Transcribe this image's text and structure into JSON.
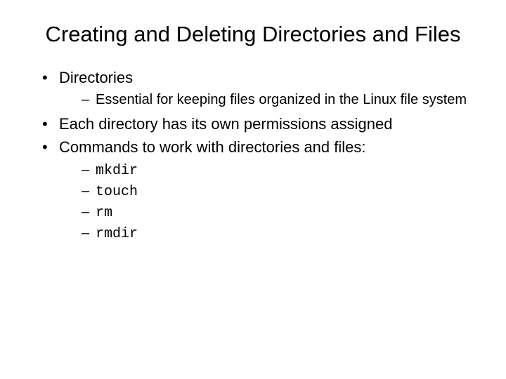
{
  "title": "Creating and Deleting Directories and Files",
  "bullets": {
    "b1": "Directories",
    "b1_sub1": "Essential for keeping files organized in the Linux file system",
    "b2": "Each directory has its own permissions assigned",
    "b3": "Commands to work with directories and files:",
    "b3_sub1": "mkdir",
    "b3_sub2": "touch",
    "b3_sub3": "rm",
    "b3_sub4": "rmdir"
  }
}
